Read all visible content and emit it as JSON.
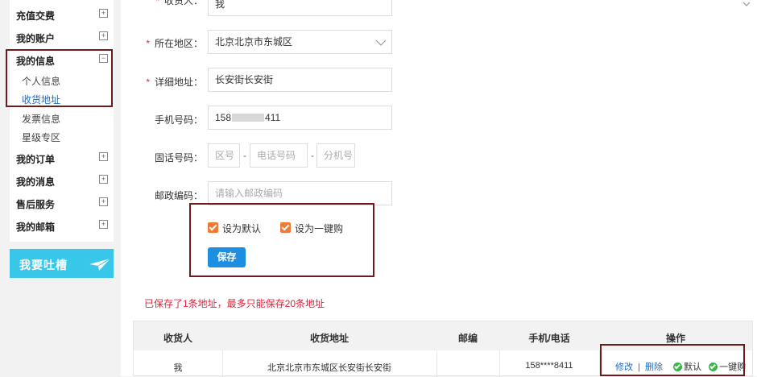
{
  "sidebar": {
    "nav": {
      "recharge": "充值交费",
      "account": "我的账户",
      "info": "我的信息",
      "orders": "我的订单",
      "messages": "我的消息",
      "aftersales": "售后服务",
      "mailbox": "我的邮箱"
    },
    "sub": {
      "personal": "个人信息",
      "address": "收货地址",
      "invoice": "发票信息",
      "star": "星级专区"
    },
    "expand_symbol": "+",
    "collapse_symbol": "−",
    "banner_text": "我要吐槽"
  },
  "form": {
    "top_partial_label": "收货人：",
    "top_partial_value": "我",
    "region_label": "所在地区：",
    "region_value": "北京北京市东城区",
    "detail_label": "详细地址：",
    "detail_value": "长安街长安街",
    "mobile_label": "手机号码：",
    "mobile_prefix": "158",
    "mobile_suffix": "411",
    "phone_label": "固话号码：",
    "area_placeholder": "区号",
    "phone_placeholder": "电话号码",
    "ext_placeholder": "分机号",
    "dash": "-",
    "zip_label": "邮政编码：",
    "zip_placeholder": "请输入邮政编码",
    "required_mark": "*",
    "default_label": "设为默认",
    "oneclick_label": "设为一键购",
    "save_label": "保存"
  },
  "notice": "已保存了1条地址，最多只能保存20条地址",
  "table": {
    "headers": [
      "收货人",
      "收货地址",
      "邮编",
      "手机/电话",
      "操作"
    ],
    "row": {
      "name": "我",
      "address": "北京北京市东城区长安街长安街",
      "zip": "",
      "phone": "158****8411",
      "edit": "修改",
      "sep": "|",
      "delete": "删除",
      "default": "默认",
      "oneclick": "一键购"
    }
  },
  "colors": {
    "accent_blue": "#1e8ee0",
    "required_red": "#e0243c",
    "highlight_border": "#6e1b1b",
    "checkbox_orange": "#f07a33",
    "banner_cyan": "#38c7e8"
  }
}
